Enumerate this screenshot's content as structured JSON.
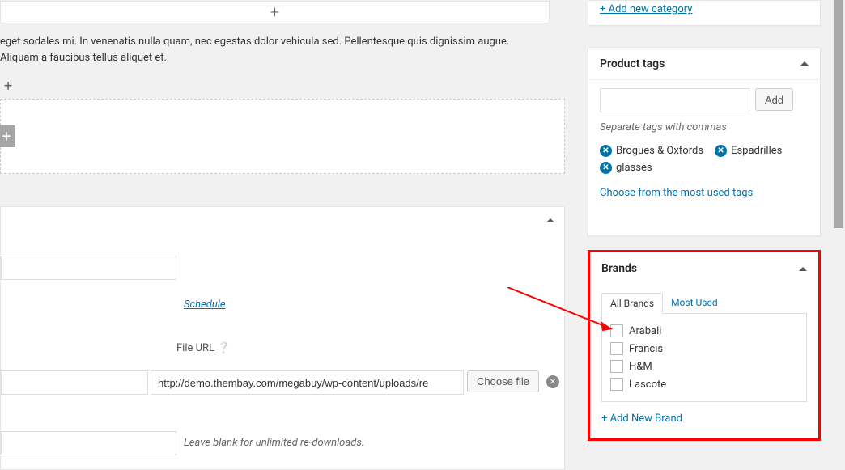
{
  "main": {
    "content_text": "eget sodales mi. In venenatis nulla quam, nec egestas dolor vehicula sed. Pellentesque quis dignissim augue. Aliquam a faucibus tellus aliquet et.",
    "schedule_label": "Schedule",
    "file_url_label": "File URL",
    "file_url_value": "http://demo.thembay.com/megabuy/wp-content/uploads/re",
    "choose_file_label": "Choose file",
    "limit_hint": "Leave blank for unlimited re-downloads."
  },
  "category": {
    "add_new_link": "+ Add new category"
  },
  "tags": {
    "title": "Product tags",
    "add_btn": "Add",
    "hint": "Separate tags with commas",
    "items": [
      "Brogues & Oxfords",
      "Espadrilles",
      "glasses"
    ],
    "choose_link": "Choose from the most used tags"
  },
  "brands": {
    "title": "Brands",
    "tab_all": "All Brands",
    "tab_most": "Most Used",
    "items": [
      "Arabali",
      "Francis",
      "H&M",
      "Lascote"
    ],
    "add_link": "+ Add New Brand"
  }
}
